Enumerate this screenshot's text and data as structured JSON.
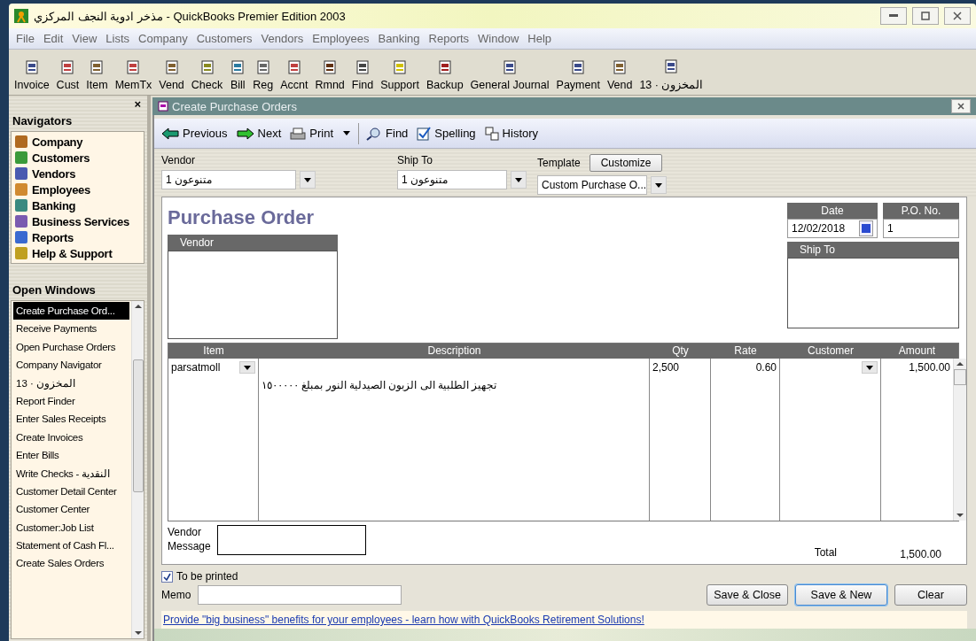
{
  "window": {
    "title": "مذخر ادوية النجف المركزي - QuickBooks Premier Edition 2003"
  },
  "menu": [
    "File",
    "Edit",
    "View",
    "Lists",
    "Company",
    "Customers",
    "Vendors",
    "Employees",
    "Banking",
    "Reports",
    "Window",
    "Help"
  ],
  "toolbar": [
    {
      "label": "Invoice",
      "kind": "form"
    },
    {
      "label": "Cust",
      "kind": "list"
    },
    {
      "label": "Item",
      "kind": "box"
    },
    {
      "label": "MemTx",
      "kind": "list"
    },
    {
      "label": "Vend",
      "kind": "box"
    },
    {
      "label": "Check",
      "kind": "check"
    },
    {
      "label": "Bill",
      "kind": "bill"
    },
    {
      "label": "Reg",
      "kind": "register"
    },
    {
      "label": "Accnt",
      "kind": "list"
    },
    {
      "label": "Rmnd",
      "kind": "hand"
    },
    {
      "label": "Find",
      "kind": "find"
    },
    {
      "label": "Support",
      "kind": "help"
    },
    {
      "label": "Backup",
      "kind": "disk"
    },
    {
      "label": "General Journal",
      "kind": "form"
    },
    {
      "label": "Payment",
      "kind": "form"
    },
    {
      "label": "Vend",
      "kind": "box"
    },
    {
      "label": "13 · المخزون",
      "kind": "form"
    }
  ],
  "navigators": {
    "close": "×",
    "title": "Navigators",
    "items": [
      {
        "label": "Company",
        "color": "#b06a20"
      },
      {
        "label": "Customers",
        "color": "#3a9a3a"
      },
      {
        "label": "Vendors",
        "color": "#4a5ab0"
      },
      {
        "label": "Employees",
        "color": "#d08a30"
      },
      {
        "label": "Banking",
        "color": "#3a8a80"
      },
      {
        "label": "Business Services",
        "color": "#7a5ab0"
      },
      {
        "label": "Reports",
        "color": "#3a6ad0"
      },
      {
        "label": "Help & Support",
        "color": "#c0a020"
      }
    ]
  },
  "open_windows": {
    "title": "Open Windows",
    "items": [
      {
        "label": "Create Purchase Ord...",
        "selected": true
      },
      {
        "label": "Receive Payments",
        "selected": false
      },
      {
        "label": "Open Purchase Orders",
        "selected": false
      },
      {
        "label": "Company Navigator",
        "selected": false
      },
      {
        "label": "المخزون · 13",
        "selected": false
      },
      {
        "label": "Report Finder",
        "selected": false
      },
      {
        "label": "Enter Sales Receipts",
        "selected": false
      },
      {
        "label": "Create Invoices",
        "selected": false
      },
      {
        "label": "Enter Bills",
        "selected": false
      },
      {
        "label": "Write Checks - النقدية",
        "selected": false
      },
      {
        "label": "Customer Detail Center",
        "selected": false
      },
      {
        "label": "Customer Center",
        "selected": false
      },
      {
        "label": "Customer:Job List",
        "selected": false
      },
      {
        "label": "Statement of Cash Fl...",
        "selected": false
      },
      {
        "label": "Create Sales Orders",
        "selected": false
      }
    ]
  },
  "form": {
    "title": "Create Purchase Orders",
    "actions": [
      {
        "label": "Previous",
        "kind": "back"
      },
      {
        "label": "Next",
        "kind": "forward"
      },
      {
        "label": "Print",
        "kind": "print"
      },
      {
        "label": "Find",
        "kind": "find"
      },
      {
        "label": "Spelling",
        "kind": "spell"
      },
      {
        "label": "History",
        "kind": "history"
      }
    ],
    "vendor": {
      "label": "Vendor",
      "value": "متنوعون 1"
    },
    "ship_to": {
      "label": "Ship To",
      "value": "متنوعون 1"
    },
    "template": {
      "label": "Template",
      "button": "Customize",
      "value": "Custom Purchase O..."
    },
    "heading": "Purchase Order",
    "date": {
      "label": "Date",
      "value": "12/02/2018"
    },
    "po_no": {
      "label": "P.O. No.",
      "value": "1"
    },
    "vendor_box": "Vendor",
    "ship_to_box": "Ship To",
    "columns": [
      "Item",
      "Description",
      "Qty",
      "Rate",
      "Customer",
      "Amount"
    ],
    "rows": [
      {
        "item": "parsatmoll",
        "description": "تجهيز الطلبية الى الزبون  الصيدلية النور بمبلغ ١٥٠٠٠٠٠",
        "qty": "2,500",
        "rate": "0.60",
        "amount": "1,500.00"
      }
    ],
    "vendor_message": "Vendor Message",
    "total_label": "Total",
    "total": "1,500.00",
    "to_be_printed": {
      "label": "To be printed",
      "checked": true
    },
    "memo": "Memo",
    "buttons": [
      {
        "label": "Save & Close",
        "selected": false
      },
      {
        "label": "Save & New",
        "selected": true
      },
      {
        "label": "Clear",
        "selected": false
      }
    ],
    "promo": "Provide \"big business\" benefits for your employees - learn how with QuickBooks Retirement Solutions!"
  }
}
